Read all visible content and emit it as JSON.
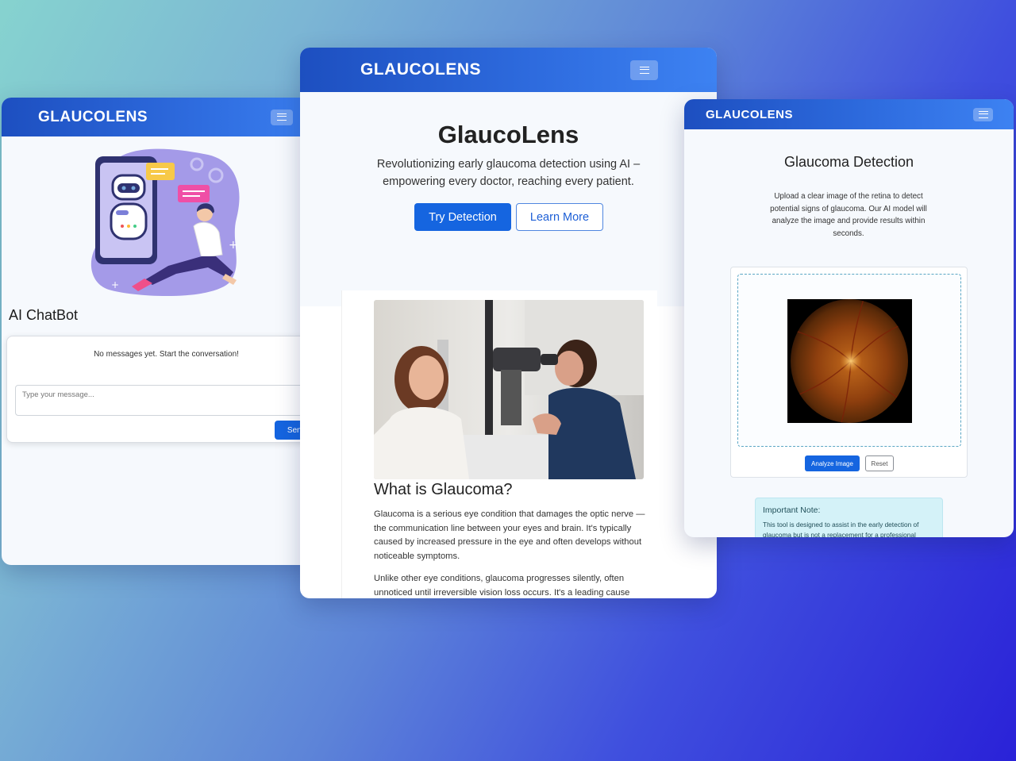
{
  "brand": "GLAUCOLENS",
  "colors": {
    "primary": "#1565e0",
    "navbar_start": "#1d4fc0",
    "navbar_end": "#3d82f2",
    "note_bg": "#d4f2f8"
  },
  "chatbot": {
    "title": "AI ChatBot",
    "empty_message": "No messages yet. Start the conversation!",
    "input_placeholder": "Type your message...",
    "send_label": "Send",
    "illustration": "robot-chatbot-illustration"
  },
  "home": {
    "title": "GlaucoLens",
    "subtitle": "Revolutionizing early glaucoma detection using AI – empowering every doctor, reaching every patient.",
    "try_label": "Try Detection",
    "learn_label": "Learn More",
    "photo": "eye-exam-slit-lamp-photo",
    "section_title": "What is Glaucoma?",
    "paragraph1": "Glaucoma is a serious eye condition that damages the optic nerve — the communication line between your eyes and brain. It's typically caused by increased pressure in the eye and often develops without noticeable symptoms.",
    "paragraph2": "Unlike other eye conditions, glaucoma progresses silently, often unnoticed until irreversible vision loss occurs. It's a leading cause"
  },
  "detection": {
    "title": "Glaucoma Detection",
    "description": "Upload a clear image of the retina to detect potential signs of glaucoma. Our AI model will analyze the image and provide results within seconds.",
    "preview": "retina-fundus-image",
    "analyze_label": "Analyze Image",
    "reset_label": "Reset",
    "note_title": "Important Note:",
    "note_text": "This tool is designed to assist in the early detection of glaucoma but is not a replacement for a professional"
  },
  "icons": {
    "menu": "hamburger-menu-icon"
  }
}
